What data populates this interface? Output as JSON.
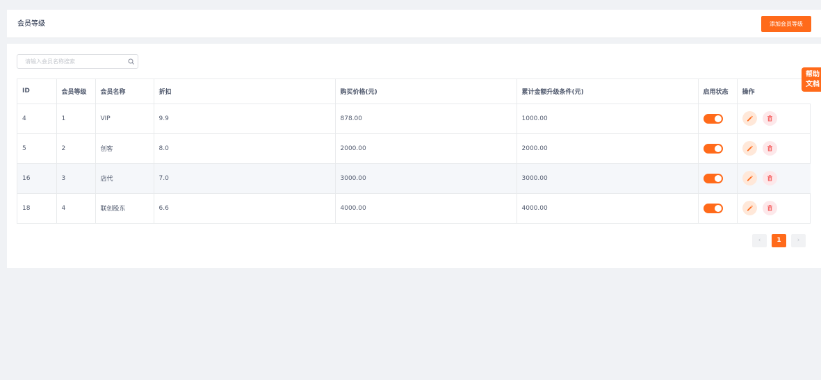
{
  "header": {
    "title": "会员等级",
    "add_button_label": "添加会员等级"
  },
  "search": {
    "placeholder": "请输入会员名称搜索",
    "value": ""
  },
  "table": {
    "columns": [
      "ID",
      "会员等级",
      "会员名称",
      "折扣",
      "购买价格(元)",
      "累计金额升级条件(元)",
      "启用状态",
      "操作"
    ],
    "rows": [
      {
        "id": "4",
        "level": "1",
        "name": "VIP",
        "discount": "9.9",
        "price": "878.00",
        "upgrade": "1000.00",
        "enabled": true
      },
      {
        "id": "5",
        "level": "2",
        "name": "创客",
        "discount": "8.0",
        "price": "2000.00",
        "upgrade": "2000.00",
        "enabled": true
      },
      {
        "id": "16",
        "level": "3",
        "name": "店代",
        "discount": "7.0",
        "price": "3000.00",
        "upgrade": "3000.00",
        "enabled": true
      },
      {
        "id": "18",
        "level": "4",
        "name": "联创股东",
        "discount": "6.6",
        "price": "4000.00",
        "upgrade": "4000.00",
        "enabled": true
      }
    ]
  },
  "pagination": {
    "prev": "‹",
    "current": "1",
    "next": "›"
  },
  "help_tab": {
    "label": "帮助文档"
  },
  "colors": {
    "accent": "#ff6a1a",
    "background": "#f0f2f5"
  }
}
